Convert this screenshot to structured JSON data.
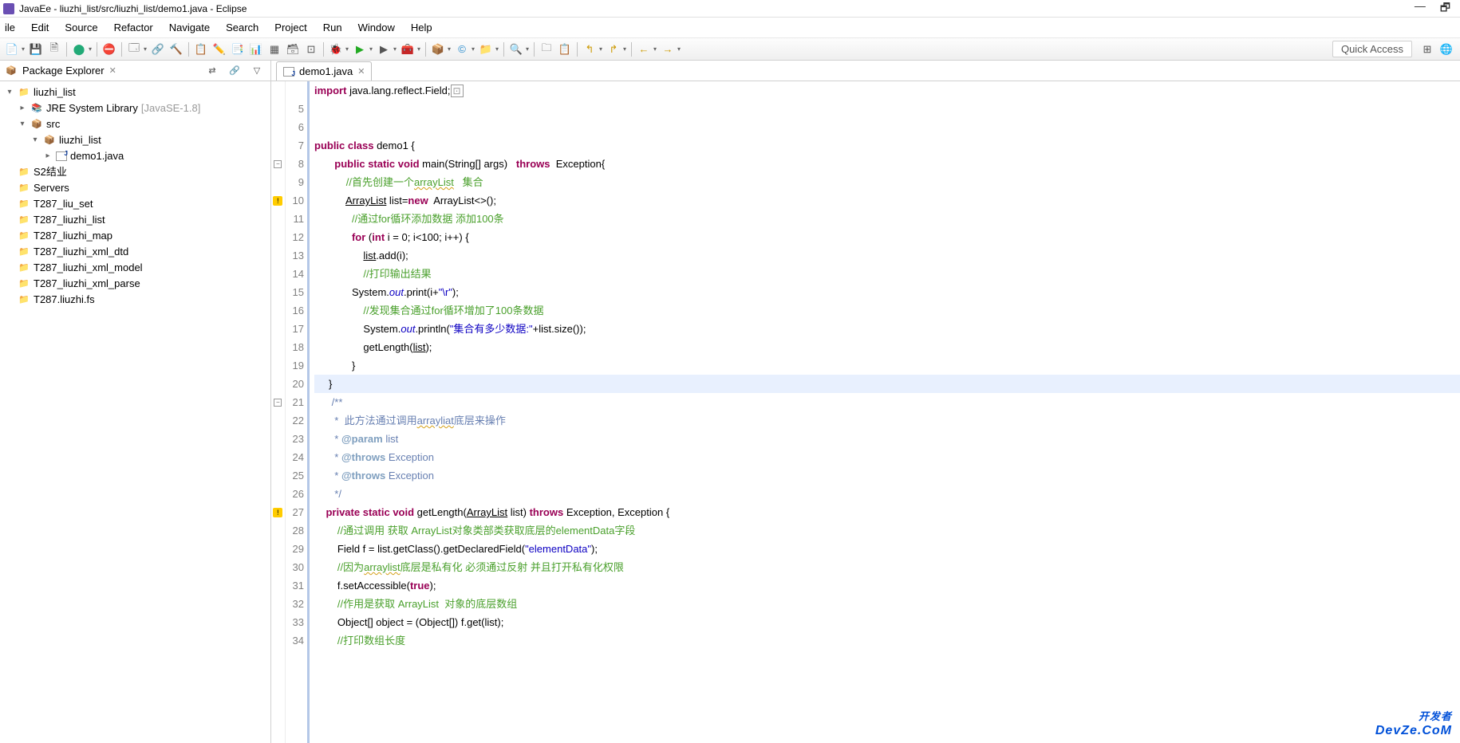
{
  "window": {
    "title": "JavaEe - liuzhi_list/src/liuzhi_list/demo1.java - Eclipse",
    "minimize": "—",
    "restore": "🗗",
    "close": ""
  },
  "menu": [
    "ile",
    "Edit",
    "Source",
    "Refactor",
    "Navigate",
    "Search",
    "Project",
    "Run",
    "Window",
    "Help"
  ],
  "quick_access": "Quick Access",
  "package_explorer": {
    "title": "Package Explorer",
    "nodes": [
      {
        "ind": 0,
        "twist": "▾",
        "icon": "proj",
        "label": "liuzhi_list"
      },
      {
        "ind": 1,
        "twist": "▸",
        "icon": "lib",
        "label": "JRE System Library",
        "extra": "[JavaSE-1.8]"
      },
      {
        "ind": 1,
        "twist": "▾",
        "icon": "pkg",
        "label": "src"
      },
      {
        "ind": 2,
        "twist": "▾",
        "icon": "pkg",
        "label": "liuzhi_list"
      },
      {
        "ind": 3,
        "twist": "▸",
        "icon": "java",
        "label": "demo1.java"
      },
      {
        "ind": 0,
        "twist": "",
        "icon": "proj",
        "label": "S2结业"
      },
      {
        "ind": 0,
        "twist": "",
        "icon": "proj",
        "label": "Servers"
      },
      {
        "ind": 0,
        "twist": "",
        "icon": "proj",
        "label": "T287_liu_set"
      },
      {
        "ind": 0,
        "twist": "",
        "icon": "proj",
        "label": "T287_liuzhi_list"
      },
      {
        "ind": 0,
        "twist": "",
        "icon": "proj",
        "label": "T287_liuzhi_map"
      },
      {
        "ind": 0,
        "twist": "",
        "icon": "proj",
        "label": "T287_liuzhi_xml_dtd"
      },
      {
        "ind": 0,
        "twist": "",
        "icon": "proj",
        "label": "T287_liuzhi_xml_model"
      },
      {
        "ind": 0,
        "twist": "",
        "icon": "proj",
        "label": "T287_liuzhi_xml_parse"
      },
      {
        "ind": 0,
        "twist": "",
        "icon": "proj",
        "label": "T287.liuzhi.fs"
      }
    ]
  },
  "editor_tab": {
    "label": "demo1.java"
  },
  "code_start_num": 5,
  "code_marks": {
    "10": "w",
    "27": "w",
    "8": "minus",
    "21": "minus"
  },
  "code_lines": [
    {
      "n": "",
      "html": "<span class='kw'>import</span> java.lang.reflect.Field;<span style='border:1px solid #999;padding:0 2px;font-size:12px;color:#999;'>⊡</span>"
    },
    {
      "n": 5,
      "html": ""
    },
    {
      "n": 6,
      "html": ""
    },
    {
      "n": 7,
      "html": "<span class='kw'>public</span> <span class='kw'>class</span> demo1 {"
    },
    {
      "n": 8,
      "html": "       <span class='kw'>public</span> <span class='kw'>static</span> <span class='kw'>void</span> main(String[] args)   <span class='kw'>throws</span>  Exception{"
    },
    {
      "n": 9,
      "html": "           <span class='cmt'>//首先创建一个</span><span class='cmt underline-squiggle'>arrayList</span>   <span class='cmt'>集合</span>"
    },
    {
      "n": 10,
      "html": "           <span class='underline'>ArrayList</span> list=<span class='kw'>new</span>  ArrayList&lt;&gt;();"
    },
    {
      "n": 11,
      "html": "             <span class='cmt'>//通过for循环添加数据 添加100条</span>"
    },
    {
      "n": 12,
      "html": "             <span class='kw'>for</span> (<span class='kw'>int</span> i = 0; i&lt;100; i++) {"
    },
    {
      "n": 13,
      "html": "                 <span class='underline'>list</span>.add(i);"
    },
    {
      "n": 14,
      "html": "                 <span class='cmt'>//打印输出结果</span>"
    },
    {
      "n": 15,
      "html": "             System.<span class='field'>out</span>.print(i+<span class='str'>\"\\r\"</span>);"
    },
    {
      "n": 16,
      "html": "                 <span class='cmt'>//发现集合通过for循环增加了100条数据</span>"
    },
    {
      "n": 17,
      "html": "                 System.<span class='field'>out</span>.println(<span class='str'>\"集合有多少数据:\"</span>+list.size());"
    },
    {
      "n": 18,
      "html": "                 getLength(<span class='underline'>list</span>);"
    },
    {
      "n": 19,
      "html": "             }"
    },
    {
      "n": 20,
      "html": "     }",
      "hl": true
    },
    {
      "n": 21,
      "html": "      <span class='jdoc'>/**</span>"
    },
    {
      "n": 22,
      "html": "       <span class='jdoc'>*</span>  <span class='jdoc'>此方法通过调用</span><span class='jdoc underline-squiggle'>arrayliat</span><span class='jdoc'>底层来操作</span>"
    },
    {
      "n": 23,
      "html": "       <span class='jdoc'>*</span> <span class='jdoc-kw'>@param</span> <span class='jdoc'>list</span>"
    },
    {
      "n": 24,
      "html": "       <span class='jdoc'>*</span> <span class='jdoc-kw'>@throws</span> <span class='jdoc'>Exception</span>"
    },
    {
      "n": 25,
      "html": "       <span class='jdoc'>*</span> <span class='jdoc-kw'>@throws</span> <span class='jdoc'>Exception</span>"
    },
    {
      "n": 26,
      "html": "       <span class='jdoc'>*/</span>"
    },
    {
      "n": 27,
      "html": "    <span class='kw'>private</span> <span class='kw'>static</span> <span class='kw'>void</span> getLength(<span class='underline'>ArrayList</span> list) <span class='kw'>throws</span> Exception, Exception {"
    },
    {
      "n": 28,
      "html": "        <span class='cmt'>//通过调用 获取 ArrayList对象类部类获取底层的elementData字段</span>"
    },
    {
      "n": 29,
      "html": "        Field f = list.getClass().getDeclaredField(<span class='str'>\"elementData\"</span>);"
    },
    {
      "n": 30,
      "html": "        <span class='cmt'>//因为</span><span class='cmt underline-squiggle'>arraylist</span><span class='cmt'>底层是私有化 必须通过反射 并且打开私有化权限</span>"
    },
    {
      "n": 31,
      "html": "        f.setAccessible(<span class='kw'>true</span>);"
    },
    {
      "n": 32,
      "html": "        <span class='cmt'>//作用是获取 ArrayList  对象的底层数组</span>"
    },
    {
      "n": 33,
      "html": "        Object[] object = (Object[]) f.get(list);"
    },
    {
      "n": 34,
      "html": "        <span class='cmt'>//打印数组长度</span>"
    }
  ],
  "watermark": {
    "line1": "开发者",
    "line2": "DevZe.CoM"
  }
}
